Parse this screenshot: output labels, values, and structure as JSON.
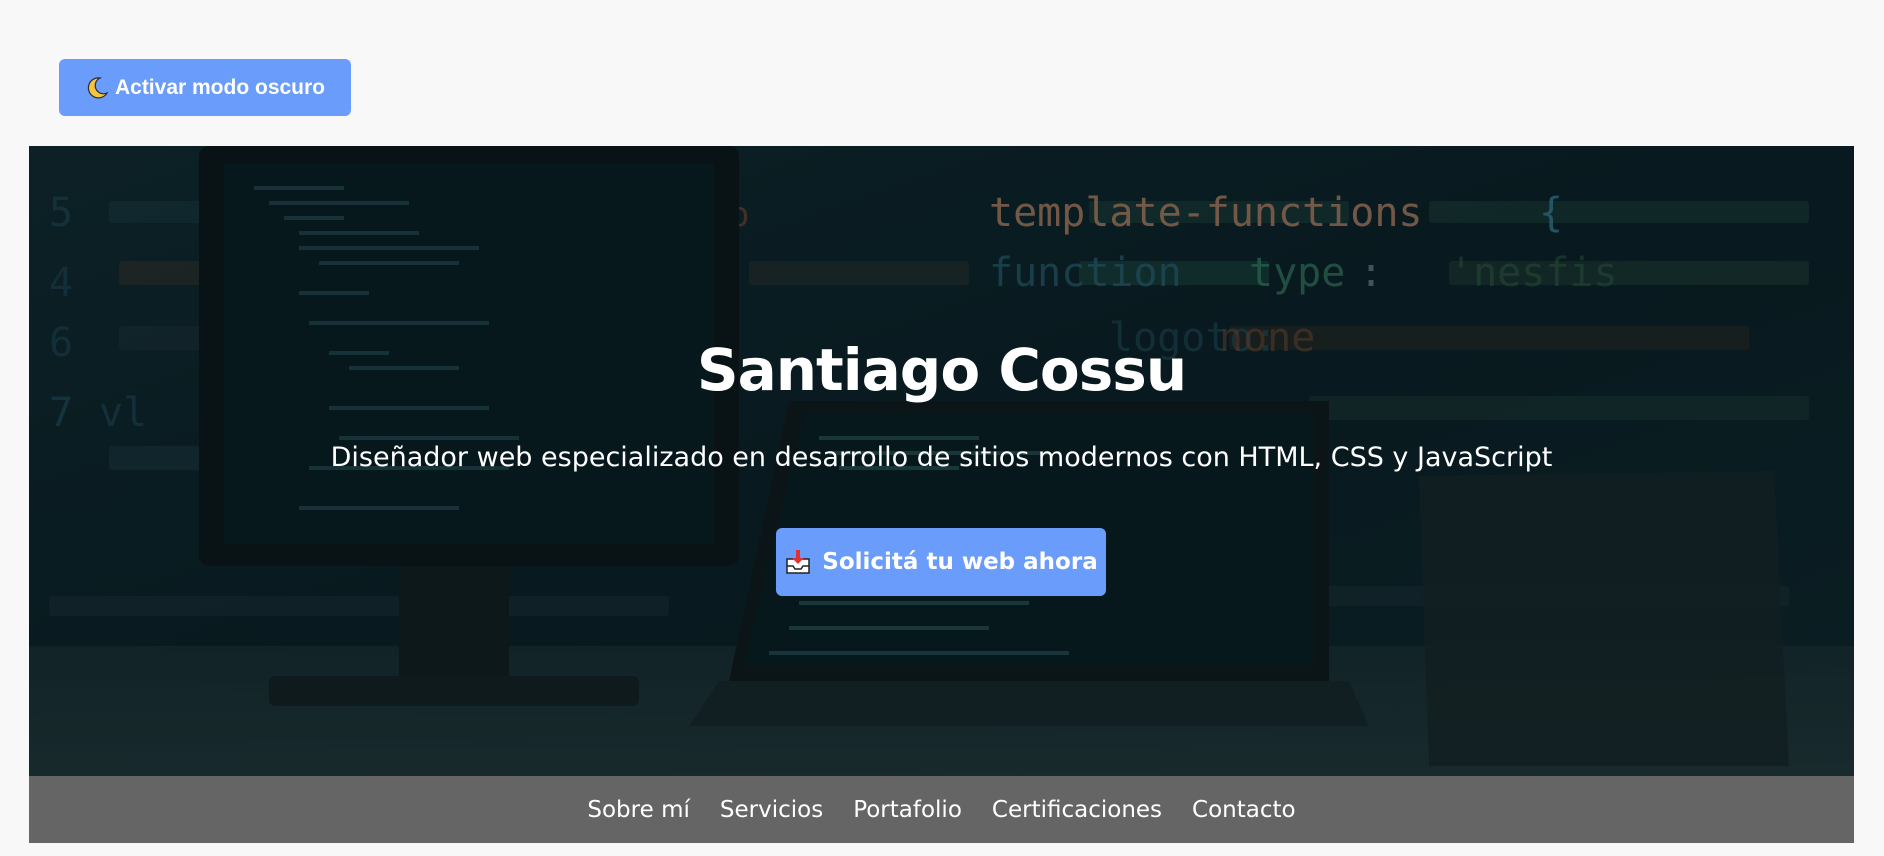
{
  "theme_toggle": {
    "label": "Activar modo oscuro",
    "icon": "crescent-moon-icon"
  },
  "hero": {
    "title": "Santiago Cossu",
    "subtitle": "Diseñador web especializado en desarrollo de sitios modernos con HTML, CSS y JavaScript",
    "cta": {
      "label": "Solicitá tu web ahora",
      "icon": "inbox-tray-icon"
    },
    "background_code_text": "template-functions"
  },
  "nav": {
    "items": [
      {
        "label": "Sobre mí"
      },
      {
        "label": "Servicios"
      },
      {
        "label": "Portafolio"
      },
      {
        "label": "Certificaciones"
      },
      {
        "label": "Contacto"
      }
    ]
  },
  "colors": {
    "accent": "#6a9cfb",
    "page_bg": "#f8f8f8",
    "nav_bg": "#656565",
    "hero_overlay": "#0b1a1f"
  }
}
